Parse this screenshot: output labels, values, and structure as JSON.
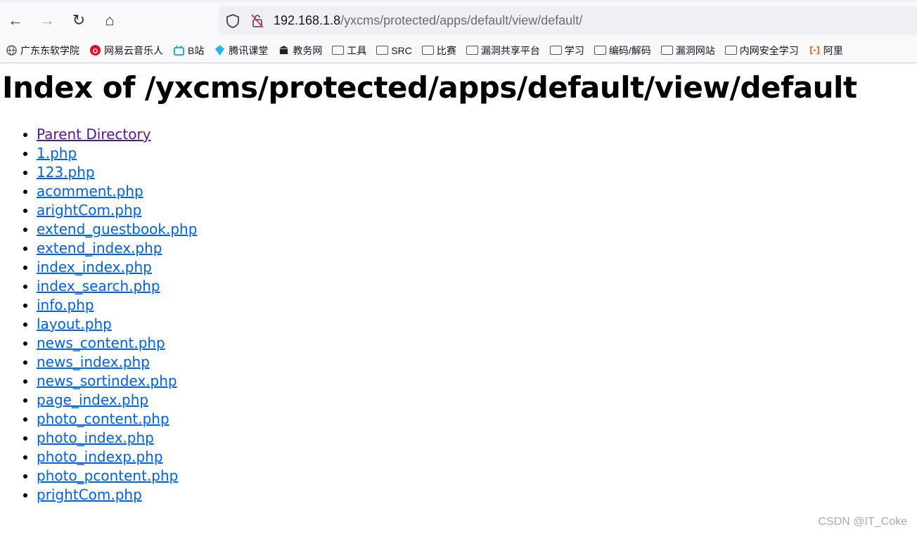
{
  "browser": {
    "url_host": "192.168.1.8",
    "url_path": "/yxcms/protected/apps/default/view/default/",
    "bookmarks": [
      {
        "label": "广东东软学院",
        "icon": "globe-icon"
      },
      {
        "label": "网易云音乐人",
        "icon": "netease-music-icon"
      },
      {
        "label": "B站",
        "icon": "bilibili-icon"
      },
      {
        "label": "腾讯课堂",
        "icon": "tencent-classroom-icon"
      },
      {
        "label": "教务网",
        "icon": "building-icon"
      },
      {
        "label": "工具",
        "icon": "folder-icon"
      },
      {
        "label": "SRC",
        "icon": "folder-icon"
      },
      {
        "label": "比赛",
        "icon": "folder-icon"
      },
      {
        "label": "漏洞共享平台",
        "icon": "folder-icon"
      },
      {
        "label": "学习",
        "icon": "folder-icon"
      },
      {
        "label": "编码/解码",
        "icon": "folder-icon"
      },
      {
        "label": "漏洞网站",
        "icon": "folder-icon"
      },
      {
        "label": "内网安全学习",
        "icon": "folder-icon"
      },
      {
        "label": "阿里",
        "icon": "aliyun-icon"
      }
    ]
  },
  "page": {
    "title": "Index of /yxcms/protected/apps/default/view/default",
    "items": [
      "Parent Directory",
      "1.php",
      "123.php",
      "acomment.php",
      "arightCom.php",
      "extend_guestbook.php",
      "extend_index.php",
      "index_index.php",
      "index_search.php",
      "info.php",
      "layout.php",
      "news_content.php",
      "news_index.php",
      "news_sortindex.php",
      "page_index.php",
      "photo_content.php",
      "photo_index.php",
      "photo_indexp.php",
      "photo_pcontent.php",
      "prightCom.php"
    ]
  },
  "watermark": "CSDN @IT_Coke",
  "colors": {
    "link": "#0060df",
    "visited": "#551a8b"
  }
}
